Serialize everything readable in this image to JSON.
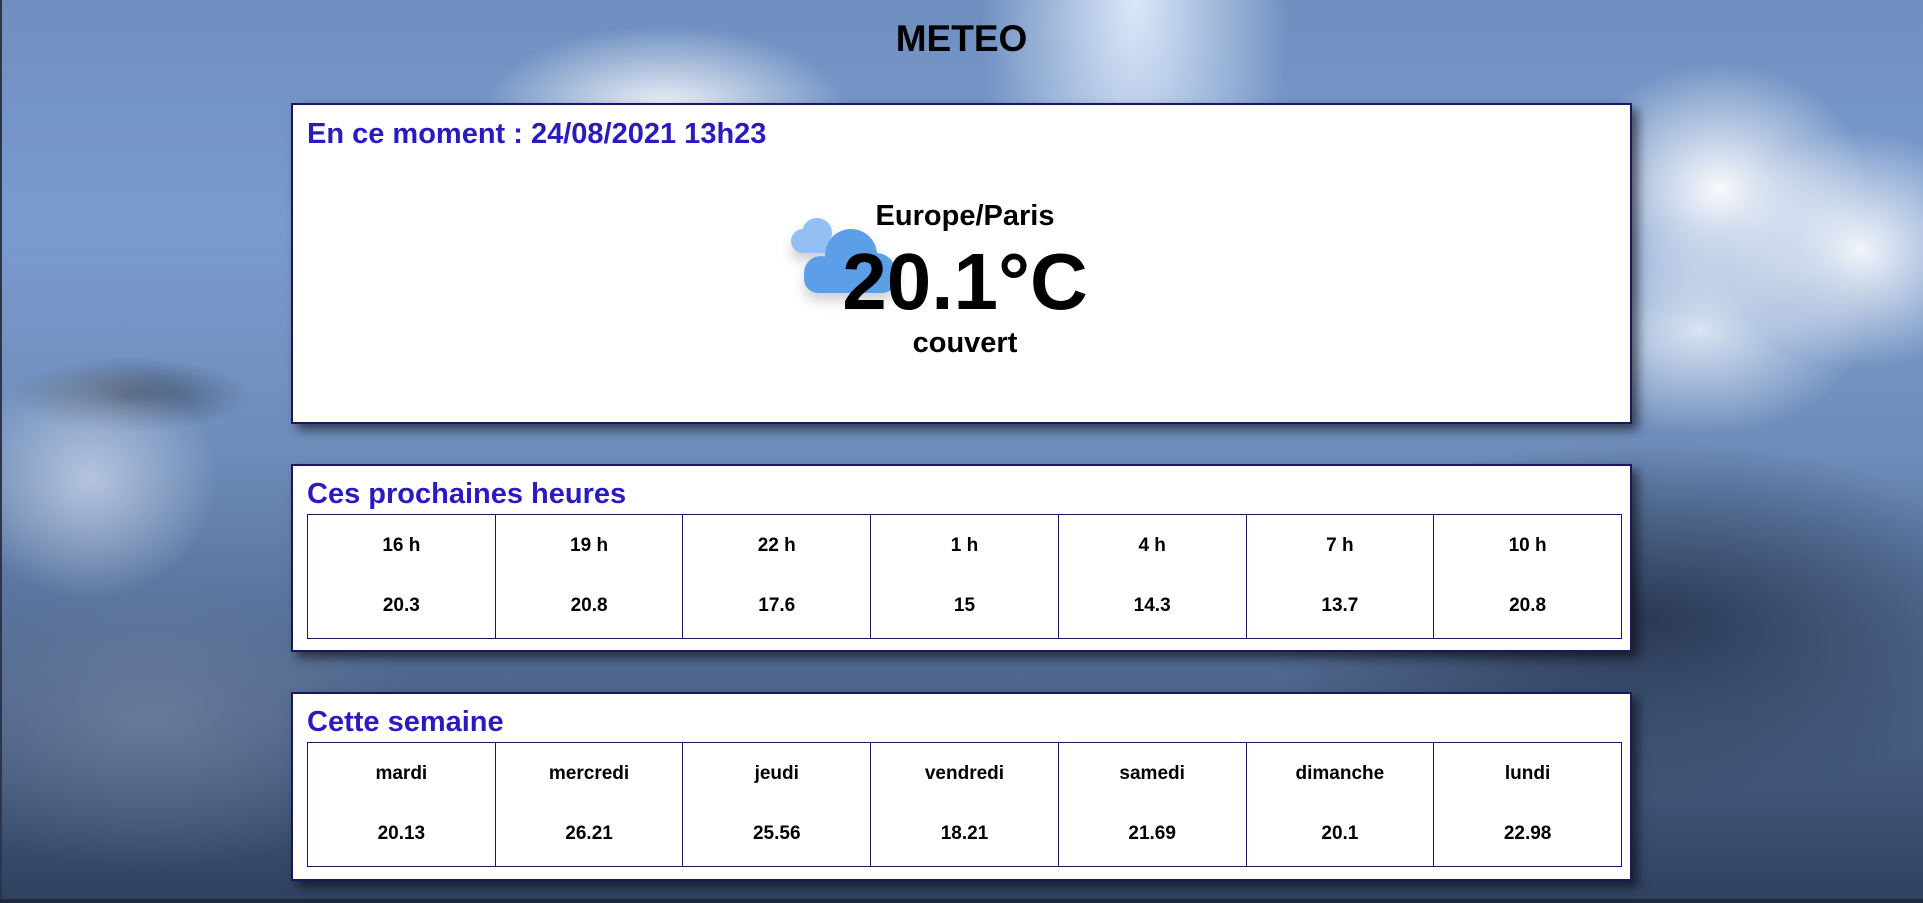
{
  "header": {
    "title": "METEO"
  },
  "now": {
    "heading": "En ce moment : 24/08/2021 13h23",
    "location": "Europe/Paris",
    "temperature": "20.1°C",
    "condition": "couvert",
    "icon": "cloudy-icon",
    "icon_color": "#5b9ee8"
  },
  "hours": {
    "heading": "Ces prochaines heures",
    "items": [
      {
        "label": "16 h",
        "value": "20.3"
      },
      {
        "label": "19 h",
        "value": "20.8"
      },
      {
        "label": "22 h",
        "value": "17.6"
      },
      {
        "label": "1 h",
        "value": "15"
      },
      {
        "label": "4 h",
        "value": "14.3"
      },
      {
        "label": "7 h",
        "value": "13.7"
      },
      {
        "label": "10 h",
        "value": "20.8"
      }
    ]
  },
  "week": {
    "heading": "Cette semaine",
    "items": [
      {
        "label": "mardi",
        "value": "20.13"
      },
      {
        "label": "mercredi",
        "value": "26.21"
      },
      {
        "label": "jeudi",
        "value": "25.56"
      },
      {
        "label": "vendredi",
        "value": "18.21"
      },
      {
        "label": "samedi",
        "value": "21.69"
      },
      {
        "label": "dimanche",
        "value": "20.1"
      },
      {
        "label": "lundi",
        "value": "22.98"
      }
    ]
  },
  "colors": {
    "heading": "#2a1bc0",
    "panel_border": "#1a1660"
  }
}
